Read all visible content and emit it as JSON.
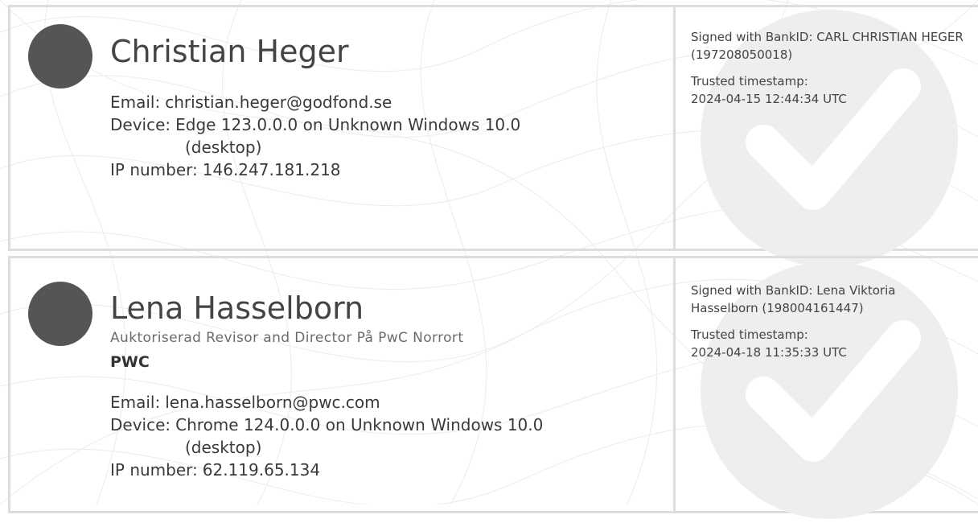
{
  "signers": [
    {
      "name": "Christian Heger",
      "email_label": "Email:",
      "email": "christian.heger@godfond.se",
      "device_label": "Device:",
      "device": "Edge 123.0.0.0 on Unknown Windows 10.0",
      "device_type": "(desktop)",
      "ip_label": "IP number:",
      "ip": "146.247.181.218",
      "bankid": "Signed with BankID: CARL CHRISTIAN HEGER (197208050018)",
      "timestamp_label": "Trusted timestamp:",
      "timestamp": "2024-04-15 12:44:34 UTC"
    },
    {
      "name": "Lena Hasselborn",
      "title": "Auktoriserad Revisor and Director På PwC Norrort",
      "company": "PWC",
      "email_label": "Email:",
      "email": "lena.hasselborn@pwc.com",
      "device_label": "Device:",
      "device": "Chrome 124.0.0.0 on Unknown Windows 10.0",
      "device_type": "(desktop)",
      "ip_label": "IP number:",
      "ip": "62.119.65.134",
      "bankid": "Signed with BankID: Lena Viktoria Hasselborn (198004161447)",
      "timestamp_label": "Trusted timestamp:",
      "timestamp": "2024-04-18 11:35:33 UTC"
    }
  ],
  "colors": {
    "avatar": "#555555",
    "border": "#dddddd",
    "watermark": "#eeeeee"
  }
}
